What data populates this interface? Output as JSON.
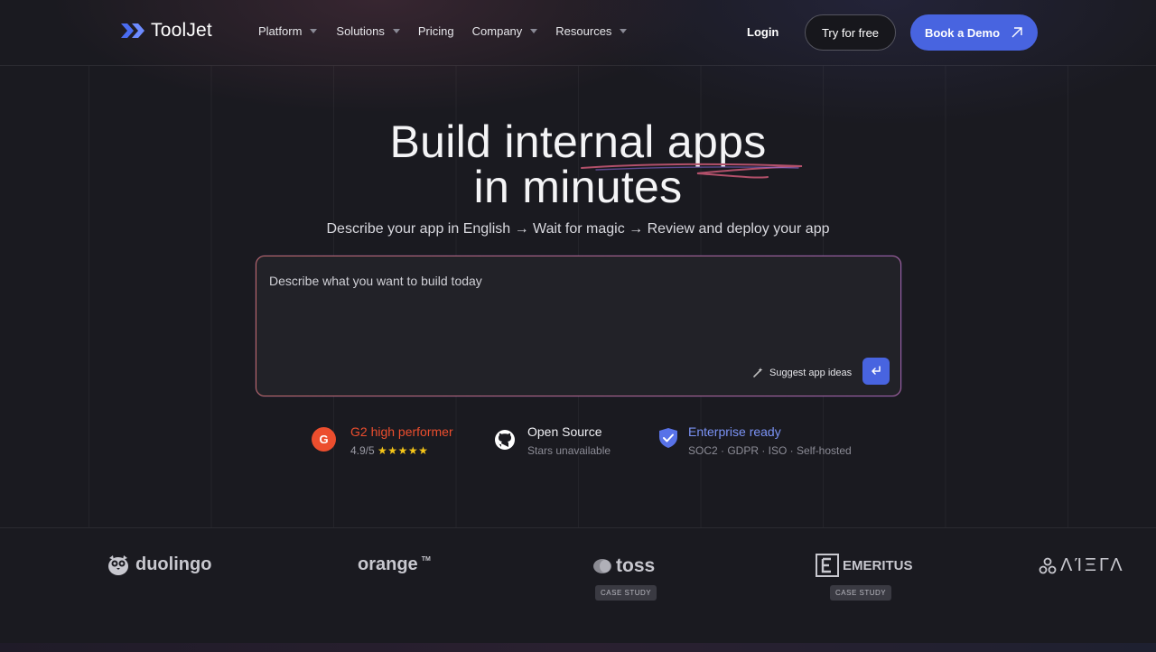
{
  "nav": {
    "brand": "ToolJet",
    "links": [
      {
        "label": "Platform",
        "dropdown": true
      },
      {
        "label": "Solutions",
        "dropdown": true
      },
      {
        "label": "Pricing",
        "dropdown": false
      },
      {
        "label": "Company",
        "dropdown": true
      },
      {
        "label": "Resources",
        "dropdown": true
      }
    ],
    "login": "Login",
    "try_free": "Try for free",
    "book_demo": "Book a Demo"
  },
  "hero": {
    "title_line1": "Build internal apps",
    "title_line2": "in minutes",
    "subtitle": "Describe your app in English → Wait for magic → Review and deploy your app"
  },
  "prompt": {
    "placeholder": "Describe what you want to build today",
    "suggest_label": "Suggest app ideas"
  },
  "badges": {
    "g2": {
      "title": "G2 high performer",
      "rating": "4.9/5",
      "stars": "★★★★★"
    },
    "open_source": {
      "title": "Open Source",
      "sub": "Stars unavailable"
    },
    "enterprise": {
      "title": "Enterprise ready",
      "sub": "SOC2 · GDPR · ISO · Self-hosted"
    }
  },
  "customers": [
    {
      "name": "duolingo",
      "case_study": ""
    },
    {
      "name": "orange",
      "case_study": ""
    },
    {
      "name": "toss",
      "case_study": "CASE STUDY"
    },
    {
      "name": "EMERITUS",
      "case_study": "CASE STUDY"
    },
    {
      "name": "ΛΊΞΓΛ",
      "case_study": ""
    }
  ],
  "colors": {
    "accent": "#4864e0",
    "g2_red": "#ec4e2e",
    "enterprise_blue": "#7b93f5",
    "background": "#1a1a20"
  }
}
